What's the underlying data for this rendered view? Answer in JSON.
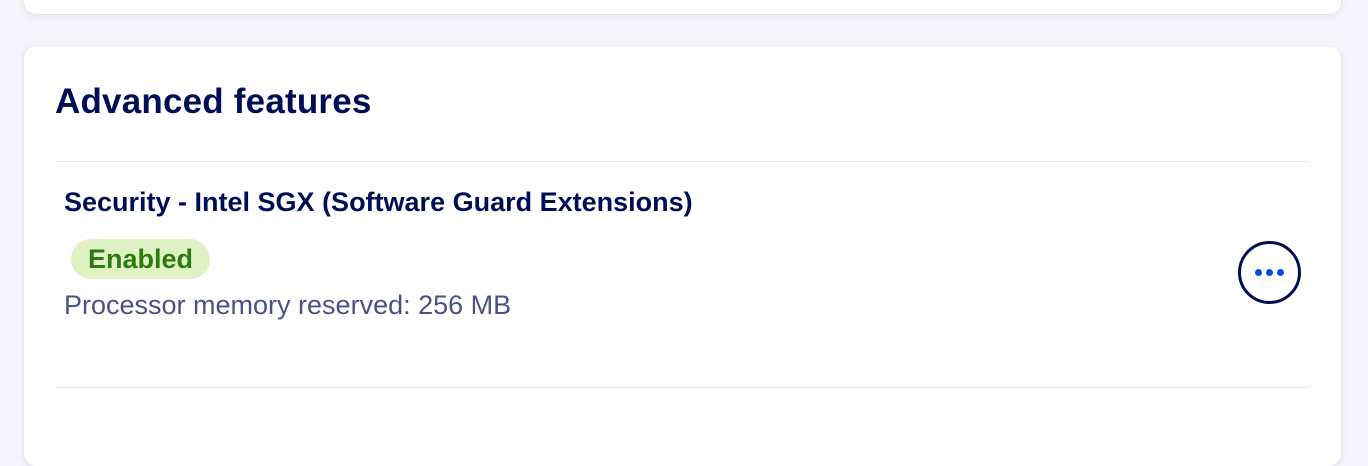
{
  "section": {
    "title": "Advanced features"
  },
  "feature": {
    "name": "Security - Intel SGX (Software Guard Extensions)",
    "status": "Enabled",
    "detail": "Processor memory reserved: 256 MB",
    "actions_icon": "more-horizontal-icon"
  },
  "colors": {
    "primary_text": "#000e56",
    "secondary_text": "#4a5188",
    "status_bg": "#dff2c4",
    "status_text": "#2d7a10",
    "action_dots": "#0050d7"
  }
}
